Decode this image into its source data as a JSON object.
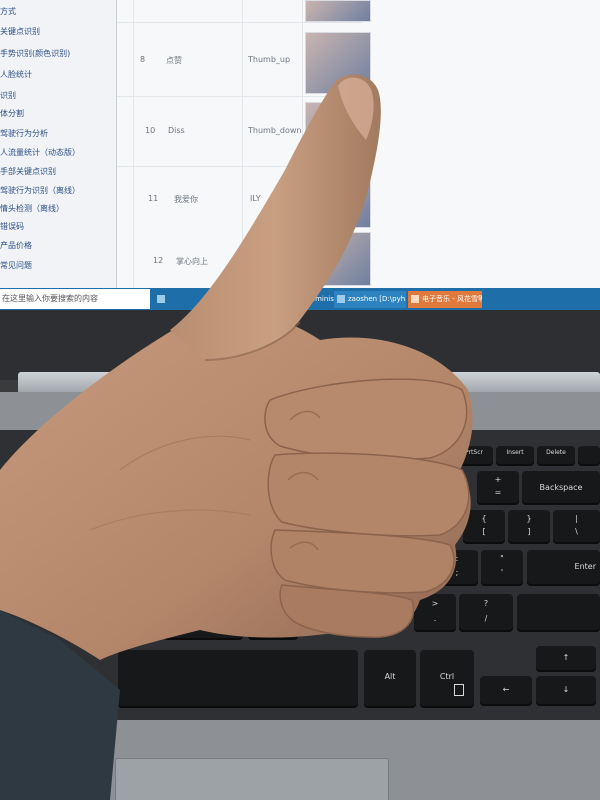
{
  "screen": {
    "sidebar_items": [
      "方式",
      "关键点识别",
      "手势识别(颜色识别)",
      "人脸统计",
      "识别",
      "体分割",
      "驾驶行为分析",
      "人流量统计（动态版）",
      "手部关键点识别",
      "驾驶行为识别（离线）",
      "情头检测（离线）",
      "错误码",
      "产品价格",
      "常见问题"
    ],
    "rows": [
      {
        "index": "8",
        "name": "点赞",
        "label": "Thumb_up"
      },
      {
        "index": "10",
        "name": "Diss",
        "label": "Thumb_down"
      },
      {
        "index": "11",
        "name": "我爱你",
        "label": "ILY"
      },
      {
        "index": "12",
        "name": "掌心向上",
        "label": ""
      }
    ]
  },
  "taskbar": {
    "search_placeholder": "在这里输入你要搜索的内容",
    "items": [
      "Adminis...",
      "zaoshen [D:\\pyh...",
      "电子音乐 - 风花雪等..."
    ]
  },
  "keyboard": {
    "keys": [
      "PrtScr",
      "Insert",
      "Delete",
      "Backspace",
      "+",
      "=",
      "{",
      "[",
      "}",
      "]",
      "|",
      "\\",
      ":",
      ";",
      "\"",
      "'",
      "Enter",
      ">",
      ".",
      "?",
      "/",
      "Alt",
      "Ctrl",
      "↑",
      "←",
      "↓"
    ]
  },
  "colors": {
    "taskbar": "#1e6fa9",
    "skin": "#b88a6d",
    "keyboard": "#2e3033"
  }
}
